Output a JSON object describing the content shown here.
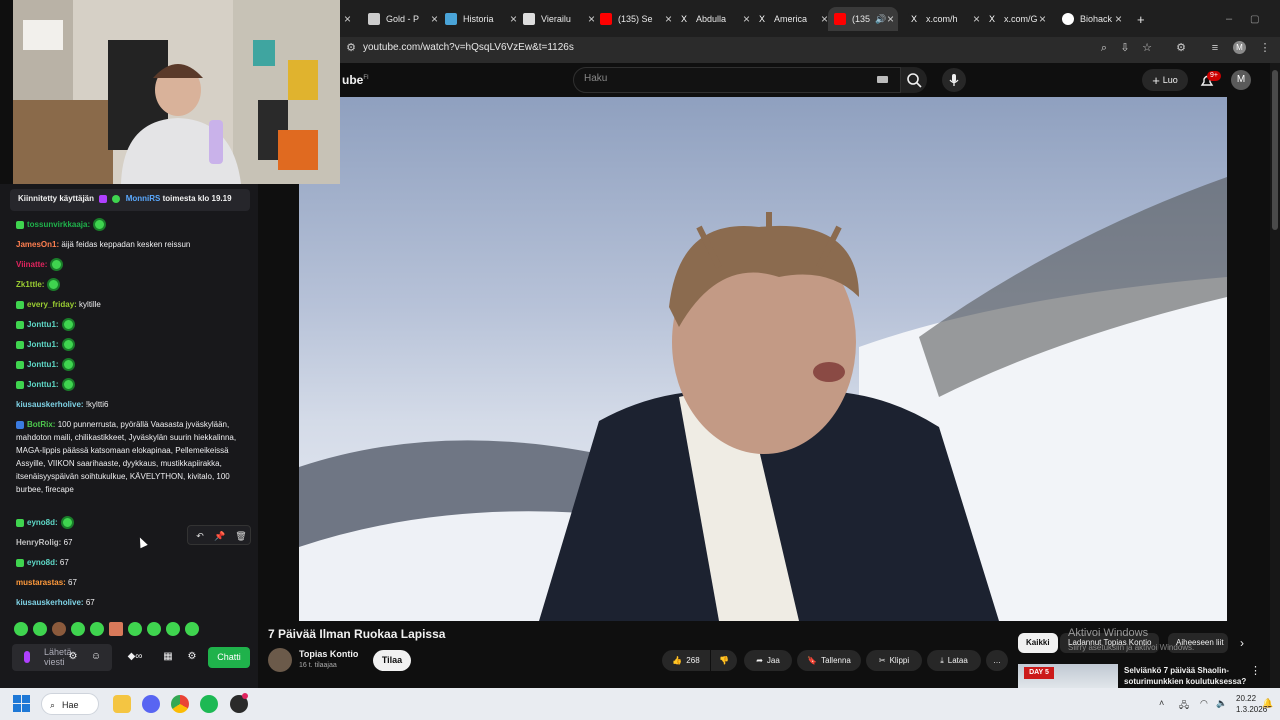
{
  "browser": {
    "tabs": [
      {
        "title": "Gold - P",
        "active": false
      },
      {
        "title": "Historia",
        "active": false
      },
      {
        "title": "Vierailu",
        "active": false
      },
      {
        "title": "(135) Se",
        "active": false
      },
      {
        "title": "Abdulla",
        "active": false
      },
      {
        "title": "America",
        "active": false
      },
      {
        "title": "(135",
        "active": true
      },
      {
        "title": "x.com/h",
        "active": false
      },
      {
        "title": "x.com/G",
        "active": false
      },
      {
        "title": "Biohack",
        "active": false
      }
    ],
    "url": "youtube.com/watch?v=hQsqLV6VzEw&t=1126s",
    "new_tab": "+"
  },
  "youtube": {
    "logo_text": "ube",
    "logo_sup": "FI",
    "search_placeholder": "Haku",
    "create_label": "Luo",
    "notifications_badge": "9+",
    "avatar_letter": "M",
    "video": {
      "title": "7 Päivää Ilman Ruokaa Lapissa",
      "channel": "Topias Kontio",
      "subscribers": "16 t. tilaajaa",
      "subscribe_label": "Tilaa",
      "likes": "268",
      "share_label": "Jaa",
      "save_label": "Tallenna",
      "clip_label": "Klippi",
      "download_label": "Lataa",
      "more": "…"
    },
    "chips": [
      "Kaikki",
      "Ladannut Topias Kontio",
      "Aiheeseen liit"
    ],
    "recommendation": {
      "title": "Selviänkö 7 päivää Shaolin-soturimunkkien koulutuksessa?"
    }
  },
  "windows_watermark": {
    "line1": "Aktivoi Windows",
    "line2": "Siirry asetuksiin ja aktivoi Windows."
  },
  "chat": {
    "pinned": {
      "prefix": "Kiinnitetty käyttäjän",
      "user": "MonniRS",
      "suffix": "toimesta klo 19.19"
    },
    "messages": [
      {
        "user": "tossunvirkkaaja:",
        "text": "",
        "emote": true,
        "color": "#1fb24b",
        "badge": "#3fd44f"
      },
      {
        "user": "JamesOn1:",
        "text": "äijä feidas keppadan kesken reissun",
        "emote": false,
        "color": "#ff7f50",
        "badge": ""
      },
      {
        "user": "Viinatte:",
        "text": "",
        "emote": true,
        "color": "#e0245e",
        "badge": ""
      },
      {
        "user": "Zk1ttle:",
        "text": "",
        "emote": true,
        "color": "#9acd32",
        "badge": ""
      },
      {
        "user": "every_friday:",
        "text": "kyltille",
        "emote": false,
        "color": "#9acd32",
        "badge": "#3fd44f"
      },
      {
        "user": "Jonttu1:",
        "text": "",
        "emote": true,
        "color": "#5fd9c7",
        "badge": "#3fd44f"
      },
      {
        "user": "Jonttu1:",
        "text": "",
        "emote": true,
        "color": "#5fd9c7",
        "badge": "#3fd44f"
      },
      {
        "user": "Jonttu1:",
        "text": "",
        "emote": true,
        "color": "#5fd9c7",
        "badge": "#3fd44f"
      },
      {
        "user": "Jonttu1:",
        "text": "",
        "emote": true,
        "color": "#5fd9c7",
        "badge": "#3fd44f"
      },
      {
        "user": "kiusauskerholive:",
        "text": "!kyltti6",
        "emote": false,
        "color": "#7fd3e6",
        "badge": ""
      },
      {
        "user": "BotRix:",
        "text": "100 punnerrusta, pyörällä Vaasasta jyväskylään, mahdoton maili, chilikastikkeet, Jyväskylän suurin hiekkalinna, MAGA-lippis päässä katsomaan elokapinaa, Pellemeikeissä Assyille, VIIKON saarihaaste, dyykkaus, mustikkapiirakka, itsenäisyyspäivän soihtukulkue, KÄVELYTHON, kivitalo, 100 burbee, firecape",
        "emote": false,
        "color": "#4dc64d",
        "badge": "#3b7be0"
      },
      {
        "user": "eyno8d:",
        "text": "",
        "emote": true,
        "color": "#5fd9c7",
        "badge": "#3fd44f"
      },
      {
        "user": "HenryRolig:",
        "text": "67",
        "emote": false,
        "color": "#c0c0c0",
        "badge": ""
      },
      {
        "user": "eyno8d:",
        "text": "67",
        "emote": false,
        "color": "#5fd9c7",
        "badge": "#3fd44f"
      },
      {
        "user": "mustarastas:",
        "text": "67",
        "emote": false,
        "color": "#ff9a3c",
        "badge": ""
      },
      {
        "user": "kiusauskerholive:",
        "text": "67",
        "emote": false,
        "color": "#7fd3e6",
        "badge": ""
      }
    ],
    "input_placeholder": "Lähetä viesti",
    "send_label": "Chatti"
  },
  "taskbar": {
    "search_label": "Hae",
    "time": "20.22",
    "date": "1.3.2026"
  }
}
